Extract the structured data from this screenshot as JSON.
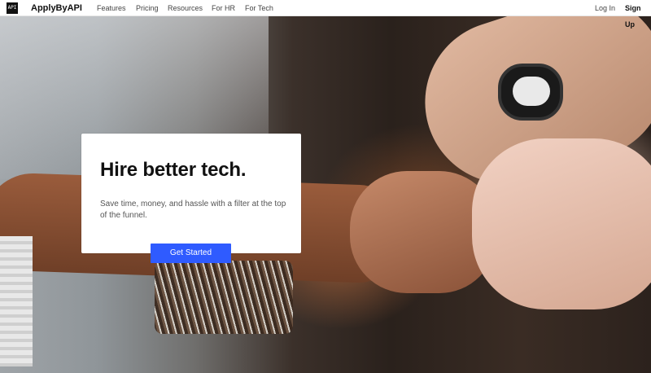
{
  "nav": {
    "logo_text": "API",
    "brand": "ApplyByAPI",
    "links": [
      "Features",
      "Pricing",
      "Resources",
      "For HR",
      "For Tech"
    ],
    "login": "Log In",
    "signup": "Sign Up"
  },
  "hero": {
    "title": "Hire better tech.",
    "subtitle": "Save time, money, and hassle with a filter at the top of the funnel.",
    "cta": "Get Started"
  },
  "colors": {
    "accent": "#2f5bff"
  }
}
